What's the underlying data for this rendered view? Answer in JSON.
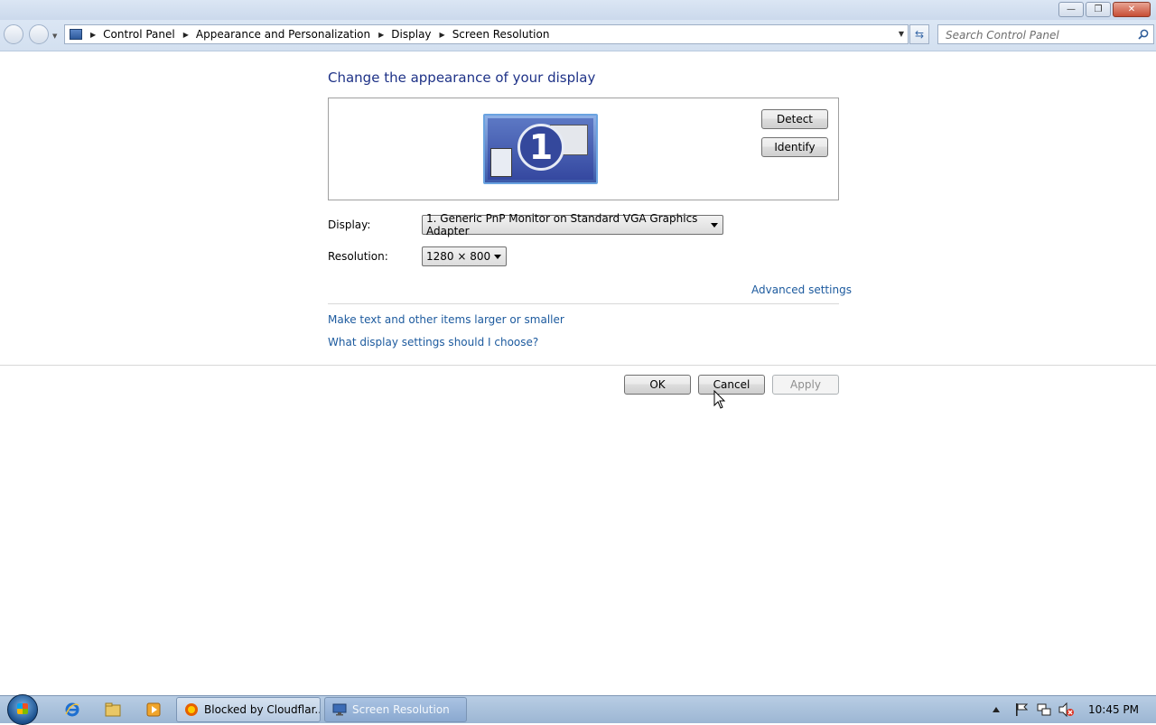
{
  "window": {
    "controls": {
      "minimize": "—",
      "restore": "❐",
      "close": "✕"
    }
  },
  "nav": {
    "breadcrumbs": [
      "Control Panel",
      "Appearance and Personalization",
      "Display",
      "Screen Resolution"
    ],
    "search_placeholder": "Search Control Panel"
  },
  "main": {
    "heading": "Change the appearance of your display",
    "monitor_number": "1",
    "detect_label": "Detect",
    "identify_label": "Identify",
    "display_label": "Display:",
    "display_value": "1. Generic PnP Monitor on Standard VGA Graphics Adapter",
    "resolution_label": "Resolution:",
    "resolution_value": "1280 × 800",
    "advanced_link": "Advanced settings",
    "text_size_link": "Make text and other items larger or smaller",
    "help_link": "What display settings should I choose?"
  },
  "footer": {
    "ok_label": "OK",
    "cancel_label": "Cancel",
    "apply_label": "Apply"
  },
  "taskbar": {
    "tasks": [
      {
        "label": "Blocked by Cloudflar..."
      },
      {
        "label": "Screen Resolution"
      }
    ],
    "clock": "10:45 PM"
  },
  "colors": {
    "heading": "#1e3287",
    "link": "#1c5a9e"
  }
}
